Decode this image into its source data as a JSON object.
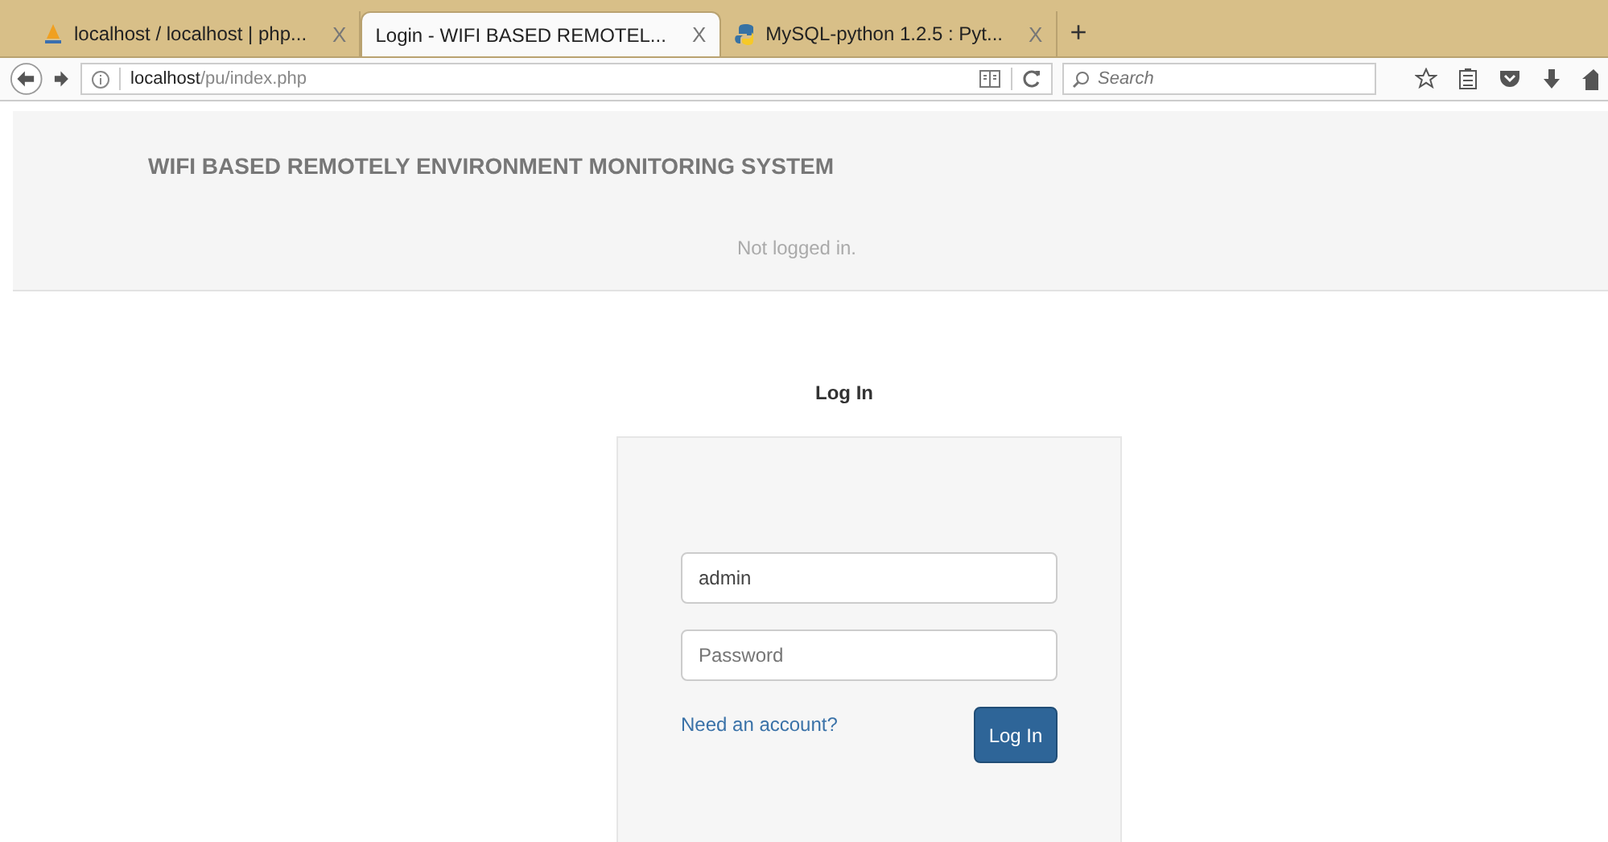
{
  "browser": {
    "tabs": [
      {
        "kind": "pma",
        "title": "localhost / localhost | php...",
        "close": "X",
        "selected": false
      },
      {
        "kind": "none",
        "title": "Login - WIFI BASED REMOTEL...",
        "close": "X",
        "selected": true
      },
      {
        "kind": "python",
        "title": "MySQL-python 1.2.5 : Pyt...",
        "close": "X",
        "selected": false
      }
    ],
    "new_tab": "+",
    "address": {
      "host": "localhost",
      "path": "/pu/index.php"
    },
    "search": {
      "placeholder": "Search"
    }
  },
  "header": {
    "title": "WIFI BASED REMOTELY ENVIRONMENT MONITORING SYSTEM",
    "status": "Not logged in."
  },
  "login": {
    "heading": "Log In",
    "username": {
      "value": "admin"
    },
    "password": {
      "placeholder": "Password"
    },
    "link": "Need an account?",
    "button": "Log In"
  }
}
